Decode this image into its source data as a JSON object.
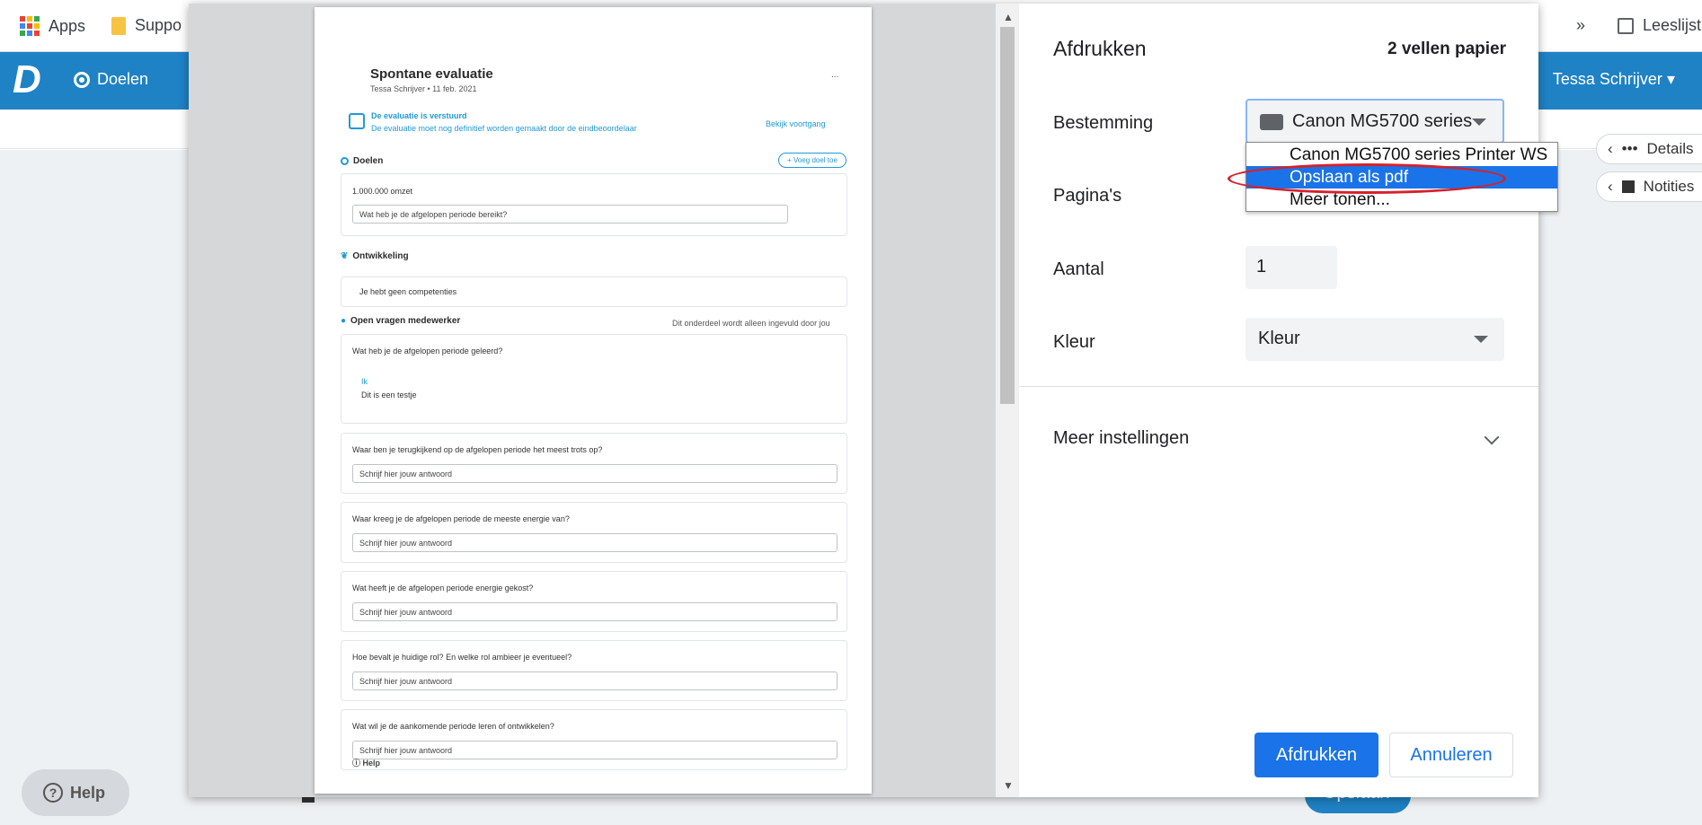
{
  "bookmarks": {
    "apps": "Apps",
    "support": "Suppo",
    "more": "»",
    "reading_list": "Leeslijst"
  },
  "app": {
    "logo": "D",
    "nav_doelen": "Doelen",
    "user": "Tessa Schrijver",
    "details": "Details",
    "notities": "Notities",
    "help": "Help",
    "opslaan": "Opslaan"
  },
  "preview_page": {
    "title": "Spontane evaluatie",
    "subtitle": "Tessa Schrijver • 11 feb. 2021",
    "menu": "...",
    "sent_title": "De evaluatie is verstuurd",
    "sent_text": "De evaluatie moet nog definitief worden gemaakt door de eindbeoordelaar",
    "progress_link": "Bekijk voortgang",
    "doelen": "Doelen",
    "add_goal": "Voeg doel toe",
    "goal_name": "1.000.000 omzet",
    "goal_question": "Wat heb je de afgelopen periode bereikt?",
    "ontwikkeling": "Ontwikkeling",
    "no_competences": "Je hebt geen competenties",
    "open_questions": "Open vragen medewerker",
    "info_note": "Dit onderdeel wordt alleen ingevuld door jou",
    "q1": "Wat heb je de afgelopen periode geleerd?",
    "ik": "Ik",
    "answer1": "Dit is een testje",
    "questions": [
      "Waar ben je terugkijkend op de afgelopen periode het meest trots op?",
      "Waar kreeg je de afgelopen periode de meeste energie van?",
      "Wat heeft je de afgelopen periode energie gekost?",
      "Hoe bevalt je huidige rol? En welke rol ambieer je eventueel?",
      "Wat wil je de aankomende periode leren of ontwikkelen?"
    ],
    "placeholder": "Schrijf hier jouw antwoord",
    "help": "Help"
  },
  "print": {
    "title": "Afdrukken",
    "sheets": "2 vellen papier",
    "destination_label": "Bestemming",
    "destination_value": "Canon MG5700 series",
    "pages_label": "Pagina's",
    "copies_label": "Aantal",
    "copies_value": "1",
    "color_label": "Kleur",
    "color_value": "Kleur",
    "more_settings": "Meer instellingen",
    "print_button": "Afdrukken",
    "cancel_button": "Annuleren",
    "dropdown_options": [
      "Canon MG5700 series Printer WS",
      "Opslaan als pdf",
      "Meer tonen..."
    ],
    "selected_option": "Opslaan als pdf"
  },
  "colors": {
    "app_blue": "#1f82c4",
    "chrome_blue": "#1a73e8",
    "highlight_ring": "#d6212b"
  }
}
